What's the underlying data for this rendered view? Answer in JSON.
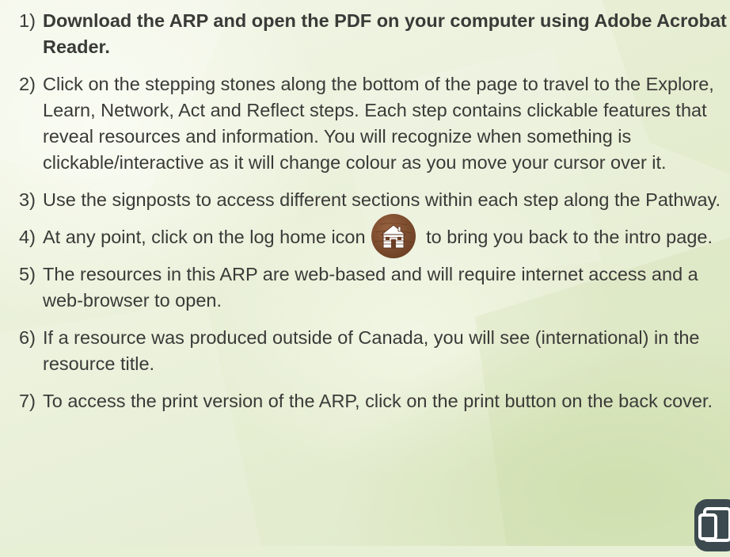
{
  "instructions": [
    {
      "number": "1)",
      "text": "Download the ARP and open the PDF on your computer using Adobe Acrobat Reader.",
      "bold": true
    },
    {
      "number": "2)",
      "text": "Click on the stepping stones along the bottom of the page to travel to the Explore, Learn, Network, Act and Reflect steps. Each step contains clickable features that reveal resources and information. You will recognize when something is clickable/interactive as it will change colour as you move your cursor over it."
    },
    {
      "number": "3)",
      "text": "Use the signposts to access different sections within each step along the Pathway."
    },
    {
      "number": "4)",
      "text_before": "At any point, click on the log home icon",
      "text_after": "to bring you back to the intro page."
    },
    {
      "number": "5)",
      "text": "The resources in this ARP are web-based and will require internet access and a web-browser to open."
    },
    {
      "number": "6)",
      "text": "If a resource was produced outside of Canada, you will see (international) in the resource title."
    },
    {
      "number": "7)",
      "text": "To access the print version of the ARP, click on the print button on the back cover."
    }
  ],
  "icons": {
    "home": "log-home-icon",
    "print": "print-icon"
  },
  "colors": {
    "text": "#3a3a38",
    "background": "#e7efd5",
    "home_icon_bg": "#7a4a2e",
    "print_icon": "#3c4a4f"
  }
}
